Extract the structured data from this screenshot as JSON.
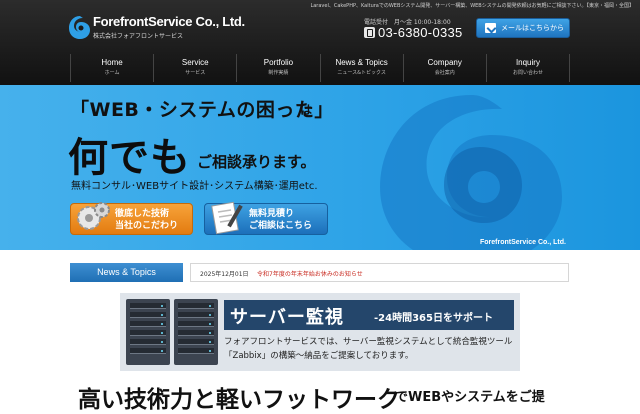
{
  "header": {
    "tagline": "Laravel、CakePHP、KalturaでのWEBシステム開発、サーバー構築、WEBシステムの開発依頼はお気軽にご相談下さい。【東京・福岡・全国】",
    "logo_name": "ForefrontService Co., Ltd.",
    "logo_sub": "株式会社フォアフロントサービス",
    "phone_hours": "電話受付　月～金 10:00-18:00",
    "phone_number": "03-6380-0335",
    "mail_button": "メールはこちらから"
  },
  "nav": [
    {
      "en": "Home",
      "jp": "ホーム"
    },
    {
      "en": "Service",
      "jp": "サービス"
    },
    {
      "en": "Portfolio",
      "jp": "制作実績"
    },
    {
      "en": "News & Topics",
      "jp": "ニュース&トピックス"
    },
    {
      "en": "Company",
      "jp": "会社案内"
    },
    {
      "en": "Inquiry",
      "jp": "お問い合わせ"
    }
  ],
  "hero": {
    "question": "「WEB・システムの困った」",
    "question_suffix": "は",
    "big": "何でも",
    "big_suffix": "ご相談承ります。",
    "sub": "無料コンサル･WEBサイト設計･システム構築･運用etc.",
    "brand": "ForefrontService Co., Ltd.",
    "btn1_line1": "徹底した技術",
    "btn1_line2": "当社のこだわり",
    "btn2_line1": "無料見積り",
    "btn2_line2": "ご相談はこちら"
  },
  "news": {
    "title": "News & Topics",
    "date": "2025年12月01日",
    "link": "令和7年度の年末年始お休みのお知らせ"
  },
  "banner": {
    "title": "サーバー監視",
    "tag": "-24時間365日をサポート",
    "desc": "フォアフロントサービスでは、サーバー監視システムとして統合監視ツール「Zabbix」の構築～納品をご提案しております。"
  },
  "bottom": {
    "headline": "高い技術力と軽いフットワーク",
    "rest": "でWEBやシステムをご提"
  },
  "colors": {
    "hero_blue": "#2ea3e7",
    "header_dark": "#1a1a1a",
    "accent_orange": "#e37b10",
    "news_red": "#c8281e",
    "banner_navy": "#24466b"
  }
}
